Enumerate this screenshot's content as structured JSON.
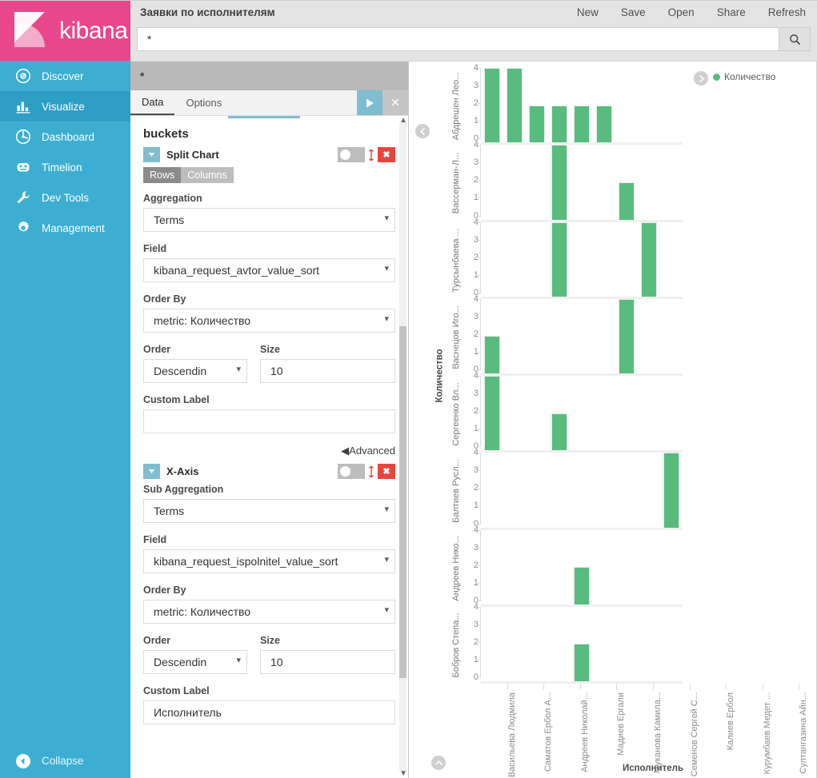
{
  "brand": {
    "name": "kibana",
    "pink": "#e8488b",
    "blue": "#3caed2"
  },
  "sidebar": {
    "items": [
      {
        "label": "Discover",
        "icon": "compass-icon"
      },
      {
        "label": "Visualize",
        "icon": "bar-chart-icon"
      },
      {
        "label": "Dashboard",
        "icon": "dashboard-icon"
      },
      {
        "label": "Timelion",
        "icon": "timelion-icon"
      },
      {
        "label": "Dev Tools",
        "icon": "wrench-icon"
      },
      {
        "label": "Management",
        "icon": "gear-icon"
      }
    ],
    "active_index": 1,
    "collapse_label": "Collapse"
  },
  "header": {
    "title": "Заявки по исполнителям",
    "actions": [
      "New",
      "Save",
      "Open",
      "Share",
      "Refresh"
    ]
  },
  "search": {
    "value": "*",
    "placeholder": "",
    "button_icon": "search-icon"
  },
  "editor": {
    "index_pattern": "*",
    "tabs": [
      {
        "label": "Data",
        "active": true
      },
      {
        "label": "Options",
        "active": false
      }
    ],
    "apply_icon": "play-icon",
    "discard_icon": "close-icon",
    "section_title": "buckets",
    "buckets": [
      {
        "name": "Split Chart",
        "row_col": {
          "rows_label": "Rows",
          "columns_label": "Columns",
          "selected": "Rows"
        },
        "agg_label": "Aggregation",
        "agg_value": "Terms",
        "field_label": "Field",
        "field_value": "kibana_request_avtor_value_sort",
        "order_by_label": "Order By",
        "order_by_value": "metric: Количество",
        "order_label": "Order",
        "order_value": "Descendin",
        "size_label": "Size",
        "size_value": "10",
        "custom_label_label": "Custom Label",
        "custom_label_value": "",
        "advanced_label": "Advanced"
      },
      {
        "name": "X-Axis",
        "agg_label": "Sub Aggregation",
        "agg_value": "Terms",
        "field_label": "Field",
        "field_value": "kibana_request_ispolnitel_value_sort",
        "order_by_label": "Order By",
        "order_by_value": "metric: Количество",
        "order_label": "Order",
        "order_value": "Descendin",
        "size_label": "Size",
        "size_value": "10",
        "custom_label_label": "Custom Label",
        "custom_label_value": "Исполнитель"
      }
    ]
  },
  "legend": {
    "collapse_icon": "chevron-right-icon",
    "items": [
      {
        "label": "Количество",
        "color": "#57bd7d"
      }
    ]
  },
  "chart_data": {
    "type": "bar",
    "title": "Заявки по исполнителям",
    "xlabel": "Исполнитель",
    "ylabel": "Количество",
    "ylim": [
      0,
      4
    ],
    "yticks": [
      0,
      1,
      2,
      3,
      4
    ],
    "grid": false,
    "legend_position": "right",
    "series_name": "Количество",
    "bar_color": "#57bd7d",
    "split": "rows",
    "categories": [
      "Васильева Людмила",
      "Саматов Ербол А...",
      "Андреев Николай...",
      "Мадиев Ергали",
      "Муканова Камила...",
      "Семенов Сергей С...",
      "Калиев Ербол",
      "Курумбаев Медет ...",
      "Султангазина Айн..."
    ],
    "rows": [
      {
        "label": "Абдрешен Лео...",
        "values": [
          4,
          4,
          2,
          2,
          2,
          2,
          0,
          0,
          0
        ]
      },
      {
        "label": "Вассерман-Л...",
        "values": [
          0,
          0,
          0,
          4,
          0,
          0,
          2,
          0,
          0
        ]
      },
      {
        "label": "Турсынбаева ...",
        "values": [
          0,
          0,
          0,
          4,
          0,
          0,
          0,
          4,
          0
        ]
      },
      {
        "label": "Васнецов Иго...",
        "values": [
          2,
          0,
          0,
          0,
          0,
          0,
          4,
          0,
          0
        ]
      },
      {
        "label": "Сергеенко Вл...",
        "values": [
          4,
          0,
          0,
          2,
          0,
          0,
          0,
          0,
          0
        ]
      },
      {
        "label": "Балтиев Русл...",
        "values": [
          0,
          0,
          0,
          0,
          0,
          0,
          0,
          0,
          4
        ]
      },
      {
        "label": "Андреев Нико...",
        "values": [
          0,
          0,
          0,
          0,
          2,
          0,
          0,
          0,
          0
        ]
      },
      {
        "label": "Бобров Степа...",
        "values": [
          0,
          0,
          0,
          0,
          2,
          0,
          0,
          0,
          0
        ]
      }
    ]
  }
}
